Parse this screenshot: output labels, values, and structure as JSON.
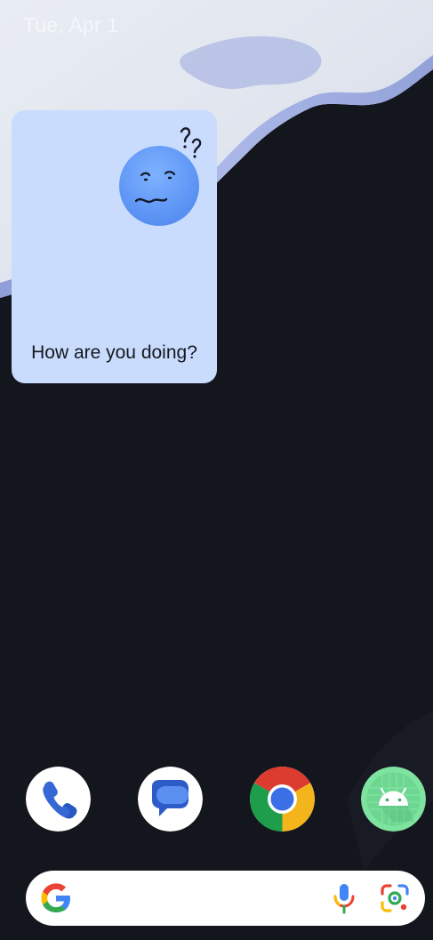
{
  "status": {
    "date": "Tue, Apr 1"
  },
  "widget": {
    "text": "How are you doing?",
    "face_icon": "confused-face-icon",
    "background": "#c9dcfd"
  },
  "dock": {
    "apps": [
      {
        "name": "Phone",
        "icon": "phone-icon",
        "color": "#3568d4"
      },
      {
        "name": "Messages",
        "icon": "messages-icon",
        "color": "#3568d4"
      },
      {
        "name": "Chrome",
        "icon": "chrome-icon",
        "color": "#4285f4"
      },
      {
        "name": "Android",
        "icon": "android-icon",
        "color": "#7fe3a0"
      }
    ]
  },
  "search_bar": {
    "logo": "google-g-icon",
    "mic": "microphone-icon",
    "lens": "google-lens-icon"
  }
}
